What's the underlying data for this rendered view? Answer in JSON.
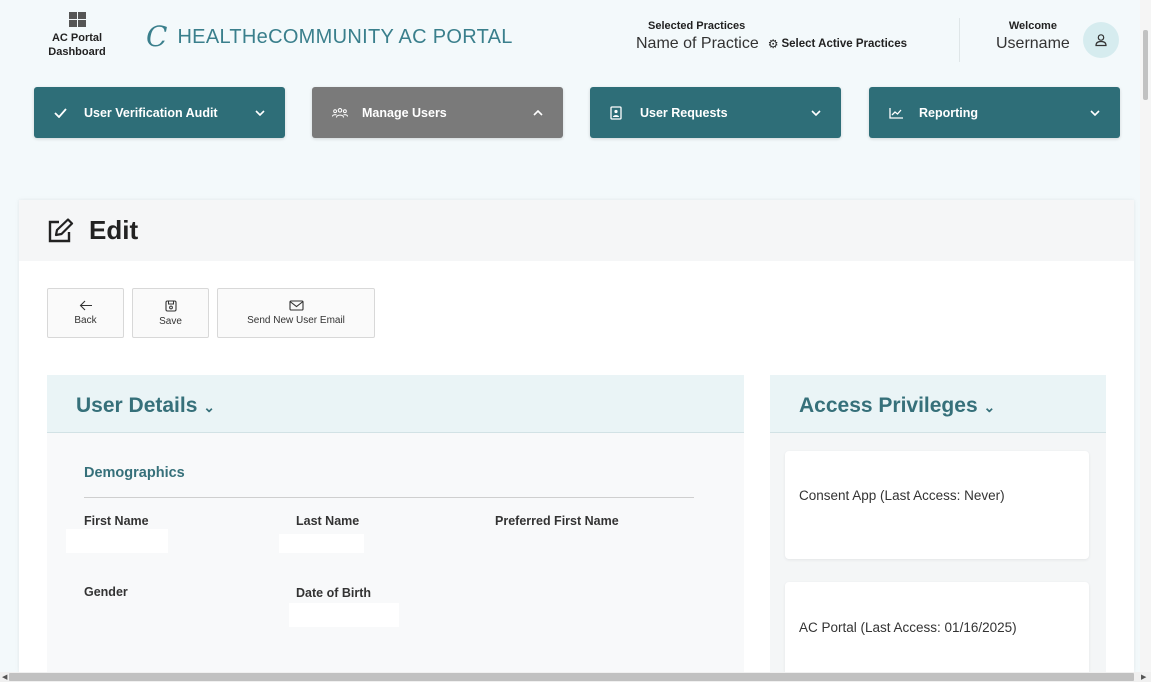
{
  "header": {
    "dashboard_label_line1": "AC Portal",
    "dashboard_label_line2": "Dashboard",
    "logo_text": "HEALTHeCOMMUNITY AC PORTAL",
    "selected_practices_label": "Selected Practices",
    "practice_name": "Name of Practice",
    "select_active_label": "Select Active Practices",
    "welcome_label": "Welcome",
    "username": "Username"
  },
  "nav": [
    {
      "label": "User Verification Audit",
      "icon": "check-icon",
      "expanded": false
    },
    {
      "label": "Manage Users",
      "icon": "users-icon",
      "expanded": true
    },
    {
      "label": "User Requests",
      "icon": "document-icon",
      "expanded": false
    },
    {
      "label": "Reporting",
      "icon": "chart-icon",
      "expanded": false
    }
  ],
  "colors": {
    "accent": "#2e6e78",
    "active_nav": "#7a7a7a",
    "heading": "#36707a"
  },
  "page": {
    "title": "Edit"
  },
  "toolbar": {
    "back": "Back",
    "save": "Save",
    "send_email": "Send New User Email"
  },
  "user_details": {
    "title": "User Details",
    "section": "Demographics",
    "fields": {
      "first_name": "First Name",
      "last_name": "Last Name",
      "preferred_first_name": "Preferred First Name",
      "gender": "Gender",
      "date_of_birth": "Date of Birth"
    }
  },
  "access": {
    "title": "Access Privileges",
    "items": [
      "Consent App (Last Access: Never)",
      "AC Portal (Last Access: 01/16/2025)"
    ]
  }
}
